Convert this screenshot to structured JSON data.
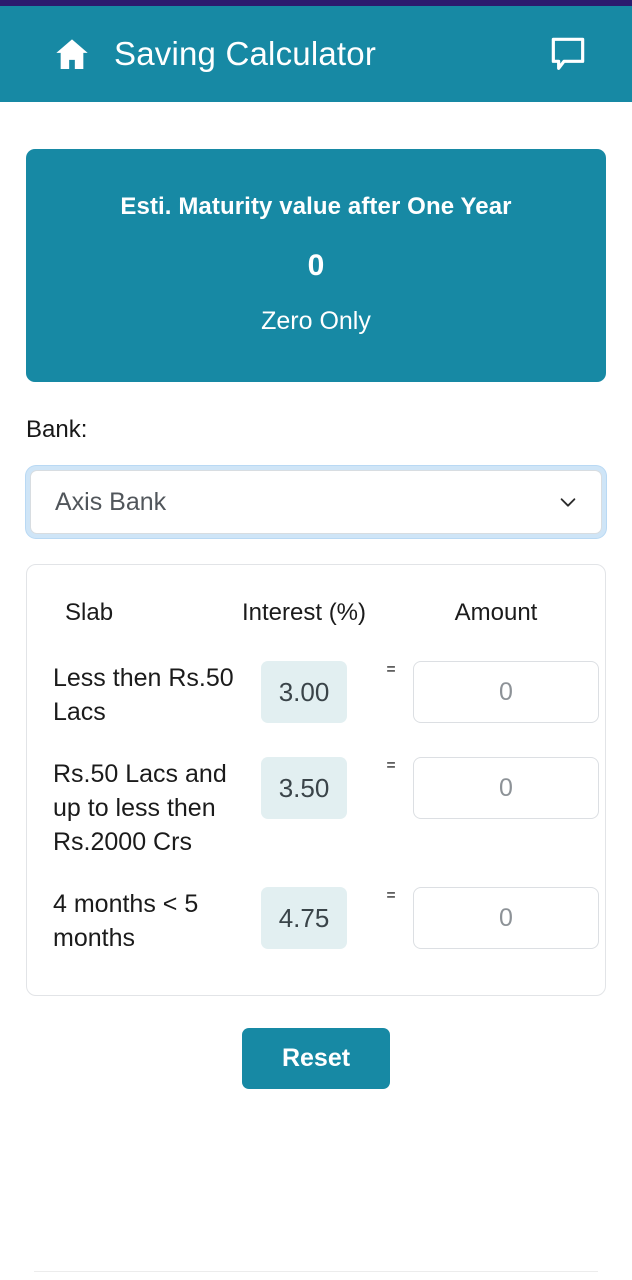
{
  "status_bar": {
    "color": "#2c1b6e"
  },
  "header": {
    "home_icon": "home-icon",
    "title": "Saving Calculator",
    "chat_icon": "chat-bubble-icon",
    "background": "#1789a4"
  },
  "maturity_card": {
    "title": "Esti. Maturity value after One Year",
    "value": "0",
    "value_in_words": "Zero Only",
    "background": "#1789a4"
  },
  "bank_field": {
    "label": "Bank:",
    "selected": "Axis Bank",
    "chevron_icon": "chevron-down-icon",
    "focus_ring_color": "#cfe5f7"
  },
  "slab_table": {
    "columns": [
      "Slab",
      "Interest (%)",
      "Amount"
    ],
    "equals_symbol": "=",
    "rows": [
      {
        "slab": "Less then Rs.50 Lacs",
        "interest": "3.00",
        "amount": "0"
      },
      {
        "slab": "Rs.50 Lacs and up to less then Rs.2000 Crs",
        "interest": "3.50",
        "amount": "0"
      },
      {
        "slab": "4 months < 5 months",
        "interest": "4.75",
        "amount": "0"
      }
    ]
  },
  "actions": {
    "reset_label": "Reset",
    "reset_color": "#1789a4"
  }
}
